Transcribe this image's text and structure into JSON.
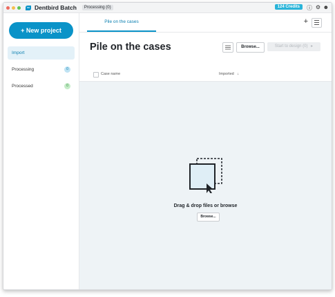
{
  "titlebar": {
    "app_title": "Dentbird Batch",
    "processing_tag": "Processing (0)",
    "credits": "124 Credits",
    "icons": [
      "help-icon",
      "settings-icon",
      "user-icon"
    ]
  },
  "sidebar": {
    "new_project_label": "+ New project",
    "items": [
      {
        "label": "Import",
        "active": true
      },
      {
        "label": "Processing",
        "count": "0"
      },
      {
        "label": "Processed",
        "count": "0"
      }
    ]
  },
  "main": {
    "tab_label": "Pile on the cases",
    "page_title": "Pile on the cases",
    "browse_label": "Browse...",
    "start_label": "Start to design (0)",
    "table": {
      "col_name": "Case name",
      "col_imported": "Imported"
    },
    "dropzone": {
      "text": "Drag & drop files or browse",
      "browse_label": "Browse..."
    }
  },
  "colors": {
    "accent": "#0a93c8",
    "credits_bg": "#2ab4d9",
    "dropzone_bg": "#eef3f6"
  }
}
